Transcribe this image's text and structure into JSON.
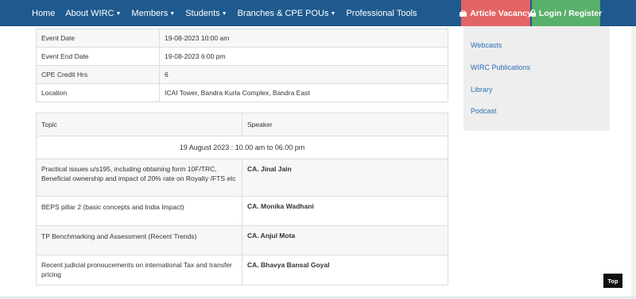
{
  "nav": {
    "items": [
      {
        "label": "Home",
        "has_dropdown": false
      },
      {
        "label": "About WIRC",
        "has_dropdown": true
      },
      {
        "label": "Members",
        "has_dropdown": true
      },
      {
        "label": "Students",
        "has_dropdown": true
      },
      {
        "label": "Branches & CPE POUs",
        "has_dropdown": true
      },
      {
        "label": "Professional Tools",
        "has_dropdown": false
      }
    ],
    "article_vacancy": "Article Vacancy",
    "login_register": "Login / Register",
    "colors": {
      "navbar": "#1f5a8e",
      "article": "#e26464",
      "login": "#59b06a"
    }
  },
  "event_details": [
    {
      "key": "Event Date",
      "value": "19-08-2023 10:00 am"
    },
    {
      "key": "Event End Date",
      "value": "19-08-2023 6:00 pm"
    },
    {
      "key": "CPE Credit Hrs",
      "value": "6"
    },
    {
      "key": "Location",
      "value": "ICAI Tower, Bandra Kurla Complex, Bandra East"
    }
  ],
  "program": {
    "header": {
      "topic": "Topic",
      "speaker": "Speaker"
    },
    "date_line": "19 August 2023 : 10.00 am to 06.00 pm",
    "rows": [
      {
        "topic": "Practical issues u/s195, including obtaining form 10F/TRC, Beneficial ownership and impact of 20% rate on Royalty /FTS etc",
        "speaker": "CA. Jinal Jain"
      },
      {
        "topic": "BEPS pillar 2 (basic concepts and India Impact)",
        "speaker": "CA. Monika Wadhani"
      },
      {
        "topic": "TP Benchmarking and Assessment (Recent Trends)",
        "speaker": "CA. Anjul Mota"
      },
      {
        "topic": "Recent judicial pronoucements on international Tax and transfer pricing",
        "speaker": "CA. Bhavya Bansal Goyal"
      }
    ]
  },
  "sidebar": {
    "links": [
      "Webcasts",
      "WIRC Publications",
      "Library",
      "Podcast"
    ]
  },
  "top_button": "Top"
}
